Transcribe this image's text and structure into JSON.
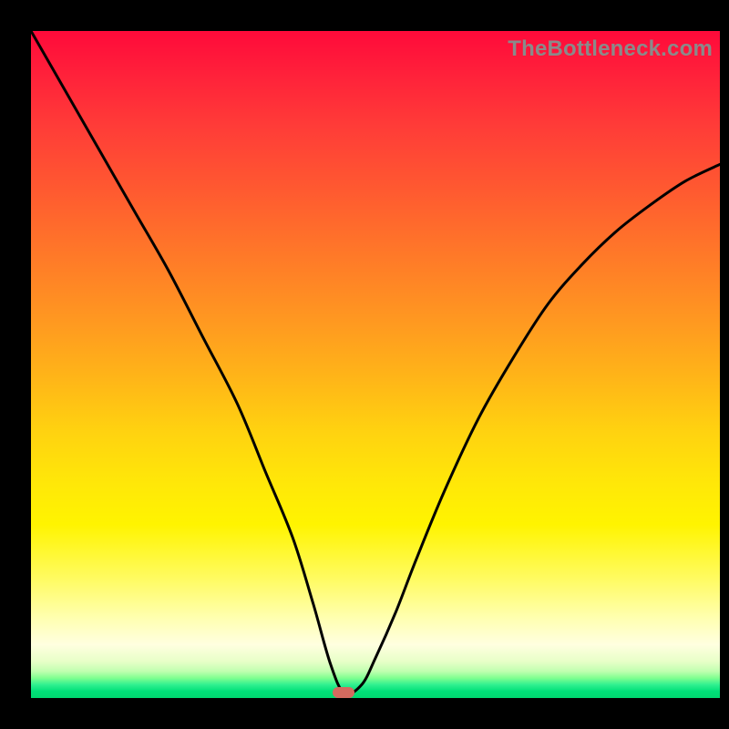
{
  "watermark": "TheBottleneck.com",
  "marker": {
    "x_frac": 0.454,
    "y_frac": 0.992,
    "color": "#d46a5f"
  },
  "chart_data": {
    "type": "line",
    "title": "",
    "xlabel": "",
    "ylabel": "",
    "xlim": [
      0,
      100
    ],
    "ylim": [
      0,
      100
    ],
    "grid": false,
    "legend": false,
    "annotations": [
      {
        "text": "TheBottleneck.com",
        "position": "top-right"
      }
    ],
    "x": [
      0,
      5,
      10,
      15,
      20,
      25,
      30,
      34,
      38,
      41,
      43.5,
      45.5,
      48,
      50,
      53,
      56,
      60,
      65,
      70,
      75,
      80,
      85,
      90,
      95,
      100
    ],
    "y_pct": [
      100,
      91,
      82,
      73,
      64,
      54,
      44,
      34,
      24,
      14,
      5,
      0.7,
      2,
      6,
      13,
      21,
      31,
      42,
      51,
      59,
      65,
      70,
      74,
      77.5,
      80
    ],
    "series": [
      {
        "name": "bottleneck-curve",
        "x": [
          0,
          5,
          10,
          15,
          20,
          25,
          30,
          34,
          38,
          41,
          43.5,
          45.5,
          48,
          50,
          53,
          56,
          60,
          65,
          70,
          75,
          80,
          85,
          90,
          95,
          100
        ],
        "y": [
          100,
          91,
          82,
          73,
          64,
          54,
          44,
          34,
          24,
          14,
          5,
          0.7,
          2,
          6,
          13,
          21,
          31,
          42,
          51,
          59,
          65,
          70,
          74,
          77.5,
          80
        ]
      }
    ],
    "min_point": {
      "x": 45.5,
      "y": 0.7
    }
  }
}
